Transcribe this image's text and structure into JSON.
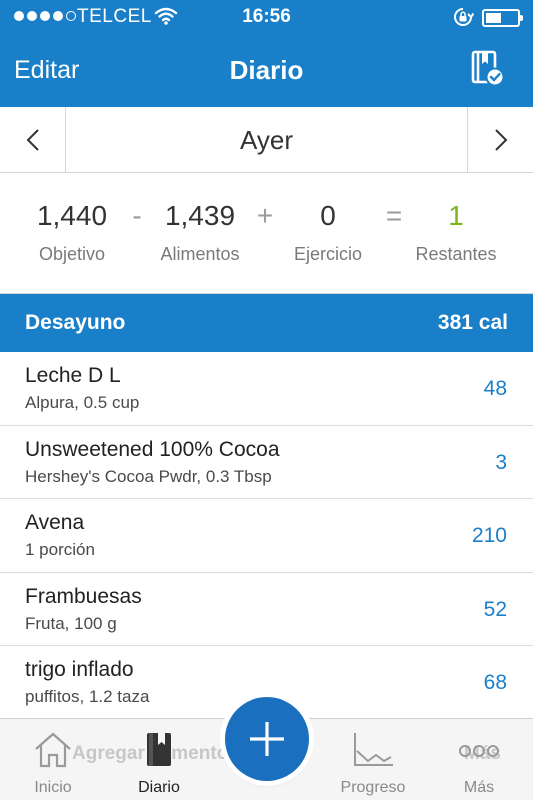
{
  "status_bar": {
    "carrier": "TELCEL",
    "time": "16:56"
  },
  "nav": {
    "edit_label": "Editar",
    "title": "Diario"
  },
  "date": {
    "label": "Ayer"
  },
  "summary": {
    "goal": "1,440",
    "goal_label": "Objetivo",
    "minus": "-",
    "food": "1,439",
    "food_label": "Alimentos",
    "plus": "+",
    "exercise": "0",
    "exercise_label": "Ejercicio",
    "equals": "=",
    "remaining": "1",
    "remaining_label": "Restantes",
    "remaining_color": "#7ab51d"
  },
  "meal": {
    "name": "Desayuno",
    "calories": "381 cal"
  },
  "foods": [
    {
      "name": "Leche D L",
      "desc": "Alpura, 0.5 cup",
      "cal": "48"
    },
    {
      "name": "Unsweetened 100% Cocoa",
      "desc": "Hershey's Cocoa Pwdr, 0.3 Tbsp",
      "cal": "3"
    },
    {
      "name": "Avena",
      "desc": "1 porción",
      "cal": "210"
    },
    {
      "name": "Frambuesas",
      "desc": "Fruta, 100 g",
      "cal": "52"
    },
    {
      "name": "trigo inflado",
      "desc": "puffitos, 1.2 taza",
      "cal": "68"
    }
  ],
  "overlay": {
    "add_food_ghost": "Agregar alimento",
    "more_ghost": "Más"
  },
  "tabs": [
    {
      "label": "Inicio",
      "icon": "home-icon"
    },
    {
      "label": "Diario",
      "icon": "diary-icon"
    },
    {
      "label": "Progreso",
      "icon": "chart-icon"
    },
    {
      "label": "Más",
      "icon": "more-icon"
    }
  ],
  "colors": {
    "brand_blue": "#1a7fc9",
    "accent_green": "#7ab51d"
  }
}
